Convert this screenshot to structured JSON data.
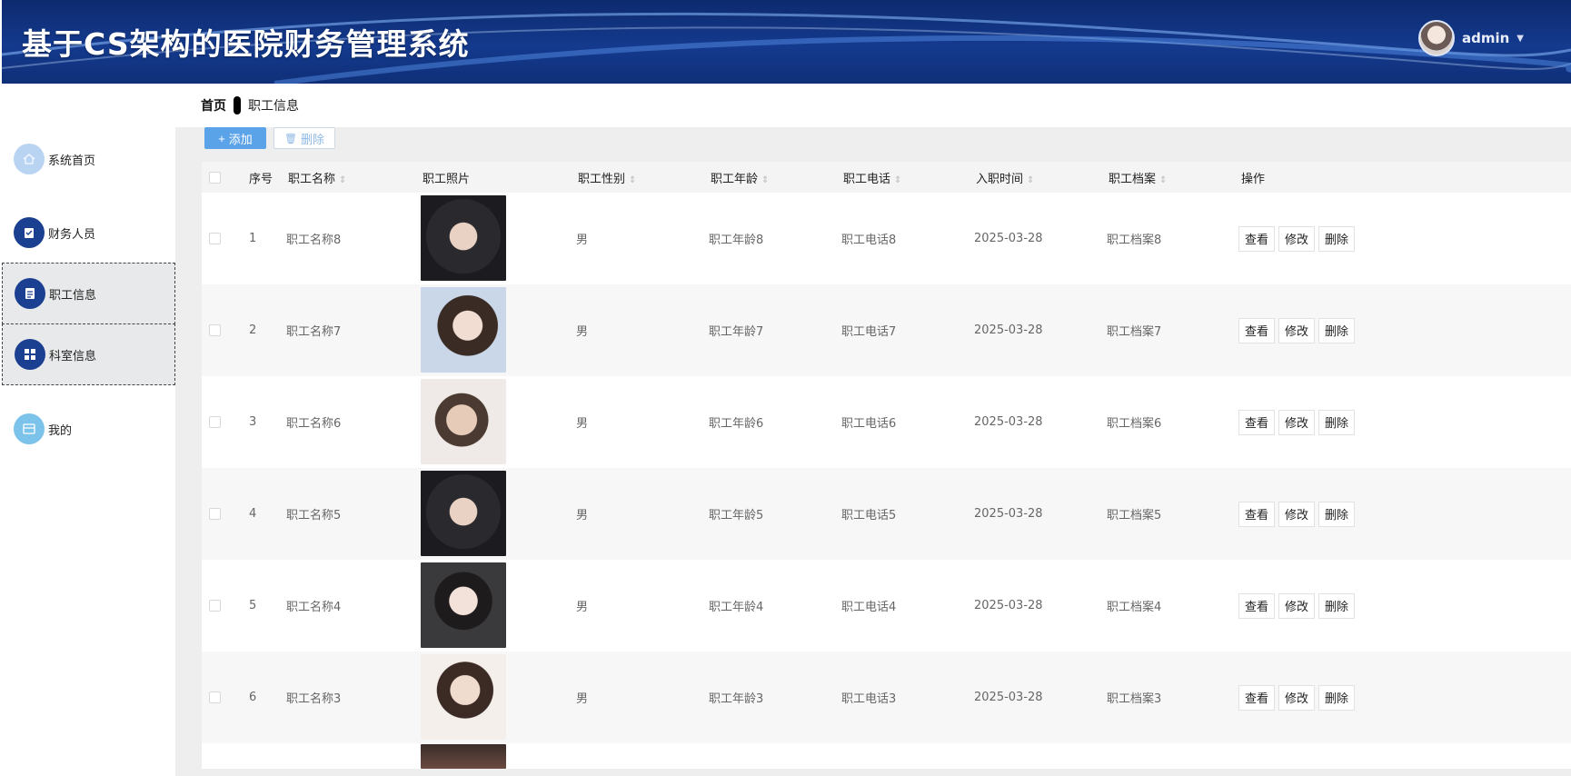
{
  "header": {
    "title": "基于CS架构的医院财务管理系统",
    "user": "admin",
    "caret": "▼"
  },
  "breadcrumb": {
    "home": "首页",
    "current": "职工信息"
  },
  "sidebar": {
    "items": [
      {
        "label": "系统首页",
        "icon": "home-icon"
      },
      {
        "label": "财务人员",
        "icon": "clipboard-icon"
      },
      {
        "label": "职工信息",
        "icon": "document-icon"
      },
      {
        "label": "科室信息",
        "icon": "grid-icon"
      },
      {
        "label": "我的",
        "icon": "card-icon"
      }
    ]
  },
  "toolbar": {
    "add_label": "添加",
    "add_icon": "+",
    "delete_label": "删除",
    "delete_icon": "🗑"
  },
  "table": {
    "headers": {
      "index": "序号",
      "name": "职工名称",
      "photo": "职工照片",
      "gender": "职工性别",
      "age": "职工年龄",
      "phone": "职工电话",
      "date": "入职时间",
      "archive": "职工档案",
      "ops": "操作"
    },
    "sort_glyph": "⇕",
    "rows": [
      {
        "index": "1",
        "name": "职工名称8",
        "gender": "男",
        "age": "职工年龄8",
        "phone": "职工电话8",
        "date": "2025-03-28",
        "archive": "职工档案8"
      },
      {
        "index": "2",
        "name": "职工名称7",
        "gender": "男",
        "age": "职工年龄7",
        "phone": "职工电话7",
        "date": "2025-03-28",
        "archive": "职工档案7"
      },
      {
        "index": "3",
        "name": "职工名称6",
        "gender": "男",
        "age": "职工年龄6",
        "phone": "职工电话6",
        "date": "2025-03-28",
        "archive": "职工档案6"
      },
      {
        "index": "4",
        "name": "职工名称5",
        "gender": "男",
        "age": "职工年龄5",
        "phone": "职工电话5",
        "date": "2025-03-28",
        "archive": "职工档案5"
      },
      {
        "index": "5",
        "name": "职工名称4",
        "gender": "男",
        "age": "职工年龄4",
        "phone": "职工电话4",
        "date": "2025-03-28",
        "archive": "职工档案4"
      },
      {
        "index": "6",
        "name": "职工名称3",
        "gender": "男",
        "age": "职工年龄3",
        "phone": "职工电话3",
        "date": "2025-03-28",
        "archive": "职工档案3"
      }
    ],
    "op_labels": {
      "view": "查看",
      "edit": "修改",
      "delete": "删除"
    }
  },
  "colors": {
    "header": "#143a8e",
    "accent": "#5ba3e8",
    "sidebar_dark": "#1b3f91",
    "sidebar_light": "#b9d3f2"
  }
}
